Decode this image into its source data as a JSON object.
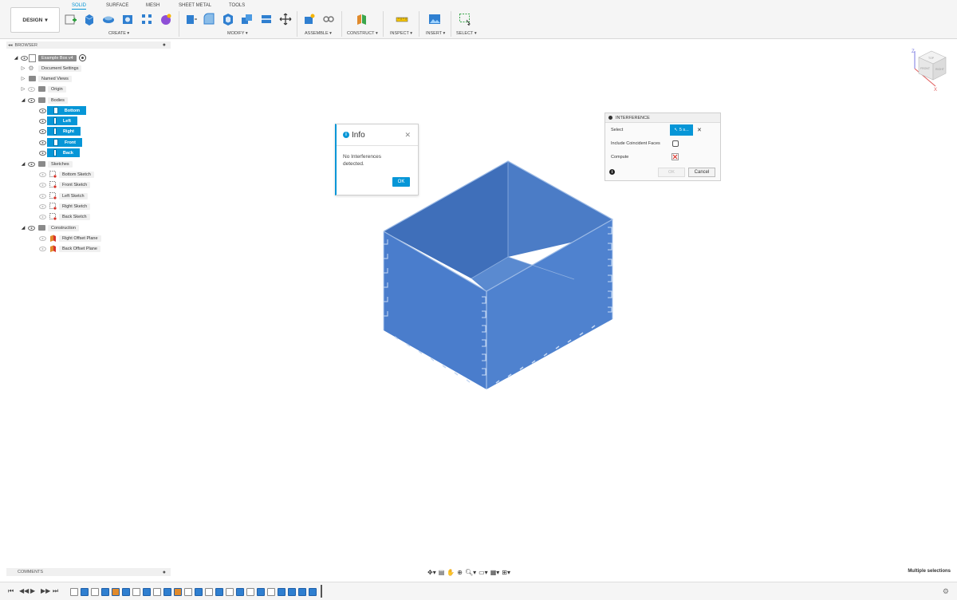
{
  "toolbar": {
    "workspace": "DESIGN",
    "tabs": [
      "SOLID",
      "SURFACE",
      "MESH",
      "SHEET METAL",
      "TOOLS"
    ],
    "active_tab": "SOLID",
    "groups": [
      "CREATE",
      "MODIFY",
      "ASSEMBLE",
      "CONSTRUCT",
      "INSPECT",
      "INSERT",
      "SELECT"
    ]
  },
  "browser": {
    "title": "BROWSER",
    "root": "Example Box v4",
    "items": {
      "document_settings": "Document Settings",
      "named_views": "Named Views",
      "origin": "Origin",
      "bodies": "Bodies",
      "sketches": "Sketches",
      "construction": "Construction"
    },
    "bodies": [
      "Bottom",
      "Left",
      "Right",
      "Front",
      "Back"
    ],
    "sketches": [
      "Bottom Sketch",
      "Front Sketch",
      "Left Sketch",
      "Right Sketch",
      "Back Sketch"
    ],
    "construction": [
      "Right Offset Plane",
      "Back Offset Plane"
    ]
  },
  "info_dialog": {
    "title": "Info",
    "message": "No Interferences detected.",
    "ok": "OK"
  },
  "interference": {
    "title": "INTERFERENCE",
    "select_label": "Select",
    "select_value": "5 s...",
    "coincident_label": "Include Coincident Faces",
    "compute_label": "Compute",
    "ok": "OK",
    "cancel": "Cancel"
  },
  "viewcube": {
    "labels": [
      "TOP",
      "FRONT",
      "RIGHT"
    ]
  },
  "comments": "COMMENTS",
  "status": "Multiple selections",
  "colors": {
    "accent": "#0696d7",
    "body_fill": "#4f80c9"
  }
}
